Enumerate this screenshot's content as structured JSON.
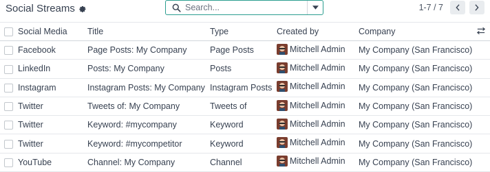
{
  "header": {
    "title": "Social Streams"
  },
  "search": {
    "placeholder": "Search..."
  },
  "pager": {
    "range": "1-7 / 7"
  },
  "columns": {
    "social_media": "Social Media",
    "title": "Title",
    "type": "Type",
    "created_by": "Created by",
    "company": "Company"
  },
  "rows": [
    {
      "social_media": "Facebook",
      "title": "Page Posts: My Company",
      "type": "Page Posts",
      "created_by": "Mitchell Admin",
      "company": "My Company (San Francisco)"
    },
    {
      "social_media": "LinkedIn",
      "title": "Posts: My Company",
      "type": "Posts",
      "created_by": "Mitchell Admin",
      "company": "My Company (San Francisco)"
    },
    {
      "social_media": "Instagram",
      "title": "Instagram Posts: My Company",
      "type": "Instagram Posts",
      "created_by": "Mitchell Admin",
      "company": "My Company (San Francisco)"
    },
    {
      "social_media": "Twitter",
      "title": "Tweets of: My Company",
      "type": "Tweets of",
      "created_by": "Mitchell Admin",
      "company": "My Company (San Francisco)"
    },
    {
      "social_media": "Twitter",
      "title": "Keyword: #mycompany",
      "type": "Keyword",
      "created_by": "Mitchell Admin",
      "company": "My Company (San Francisco)"
    },
    {
      "social_media": "Twitter",
      "title": "Keyword: #mycompetitor",
      "type": "Keyword",
      "created_by": "Mitchell Admin",
      "company": "My Company (San Francisco)"
    },
    {
      "social_media": "YouTube",
      "title": "Channel: My Company",
      "type": "Channel",
      "created_by": "Mitchell Admin",
      "company": "My Company (San Francisco)"
    }
  ],
  "icons": {
    "settings": "gear-icon",
    "search": "search-icon",
    "dropdown": "caret-down-icon",
    "prev": "chevron-left-icon",
    "next": "chevron-right-icon",
    "column_settings": "sliders-icon"
  },
  "colors": {
    "search_border": "#2a9d8f",
    "pager_button_bg": "#e9ecef"
  }
}
